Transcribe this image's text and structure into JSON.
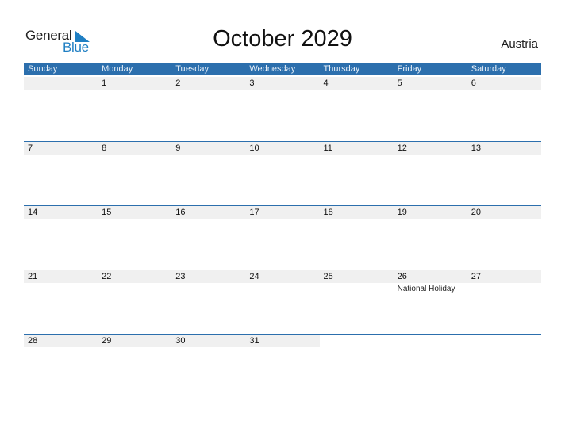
{
  "logo": {
    "word1": "General",
    "word2": "Blue"
  },
  "title": "October 2029",
  "country": "Austria",
  "colors": {
    "header_bg": "#2c6fad",
    "date_row_bg": "#f0f0f0",
    "logo_blue": "#1f7fc3"
  },
  "weekdays": [
    "Sunday",
    "Monday",
    "Tuesday",
    "Wednesday",
    "Thursday",
    "Friday",
    "Saturday"
  ],
  "weeks": [
    {
      "days": [
        "",
        "1",
        "2",
        "3",
        "4",
        "5",
        "6"
      ],
      "events": [
        "",
        "",
        "",
        "",
        "",
        "",
        ""
      ]
    },
    {
      "days": [
        "7",
        "8",
        "9",
        "10",
        "11",
        "12",
        "13"
      ],
      "events": [
        "",
        "",
        "",
        "",
        "",
        "",
        ""
      ]
    },
    {
      "days": [
        "14",
        "15",
        "16",
        "17",
        "18",
        "19",
        "20"
      ],
      "events": [
        "",
        "",
        "",
        "",
        "",
        "",
        ""
      ]
    },
    {
      "days": [
        "21",
        "22",
        "23",
        "24",
        "25",
        "26",
        "27"
      ],
      "events": [
        "",
        "",
        "",
        "",
        "",
        "National Holiday",
        ""
      ]
    },
    {
      "days": [
        "28",
        "29",
        "30",
        "31",
        "",
        "",
        ""
      ],
      "events": [
        "",
        "",
        "",
        "",
        "",
        "",
        ""
      ]
    }
  ]
}
